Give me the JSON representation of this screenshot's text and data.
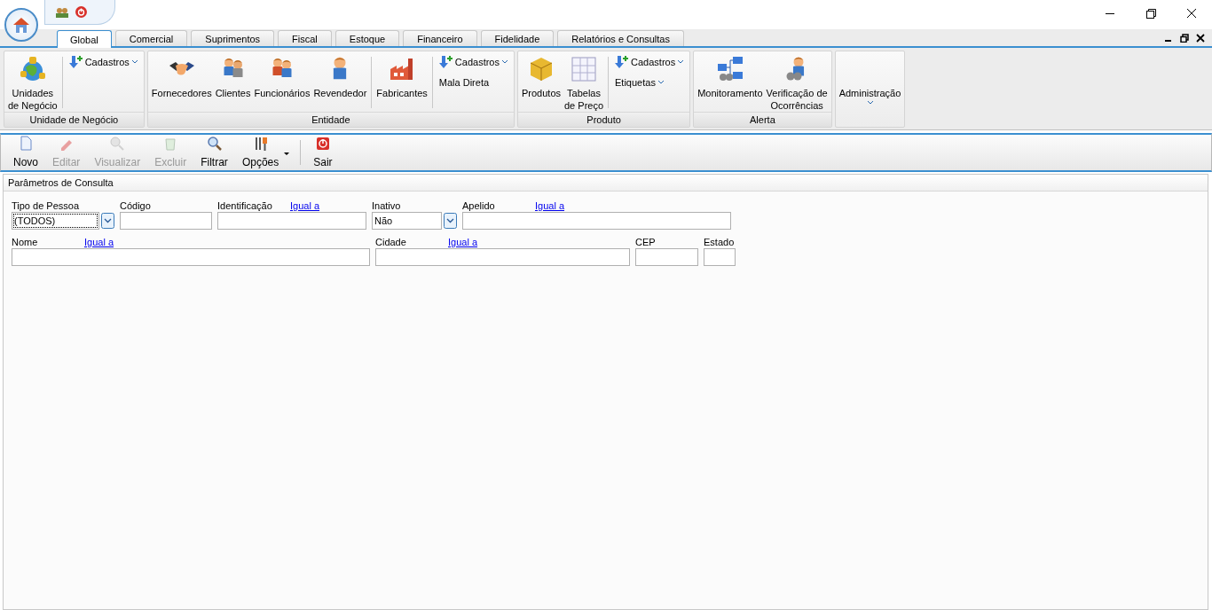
{
  "tabs": [
    {
      "label": "Global",
      "selected": true
    },
    {
      "label": "Comercial",
      "selected": false
    },
    {
      "label": "Suprimentos",
      "selected": false
    },
    {
      "label": "Fiscal",
      "selected": false
    },
    {
      "label": "Estoque",
      "selected": false
    },
    {
      "label": "Financeiro",
      "selected": false
    },
    {
      "label": "Fidelidade",
      "selected": false
    },
    {
      "label": "Relatórios e Consultas",
      "selected": false
    }
  ],
  "ribbon_groups": [
    {
      "title": "Unidade de Negócio",
      "items": [
        {
          "kind": "large",
          "lines": [
            "Unidades",
            "de Negócio"
          ]
        },
        {
          "kind": "separator"
        },
        {
          "kind": "stack",
          "items": [
            {
              "label": "Cadastros",
              "icon": true,
              "dropdown": true
            }
          ]
        }
      ]
    },
    {
      "title": "Entidade",
      "items": [
        {
          "kind": "large",
          "lines": [
            "Fornecedores"
          ]
        },
        {
          "kind": "large",
          "lines": [
            "Clientes"
          ]
        },
        {
          "kind": "large",
          "lines": [
            "Funcionários"
          ]
        },
        {
          "kind": "large",
          "lines": [
            "Revendedor"
          ]
        },
        {
          "kind": "separator"
        },
        {
          "kind": "large",
          "lines": [
            "Fabricantes"
          ]
        },
        {
          "kind": "separator"
        },
        {
          "kind": "stack",
          "items": [
            {
              "label": "Cadastros",
              "icon": true,
              "dropdown": true
            },
            {
              "label": "Mala Direta",
              "icon": false,
              "dropdown": false
            }
          ]
        }
      ]
    },
    {
      "title": "Produto",
      "items": [
        {
          "kind": "large",
          "lines": [
            "Produtos"
          ]
        },
        {
          "kind": "large",
          "lines": [
            "Tabelas",
            "de Preço"
          ]
        },
        {
          "kind": "separator"
        },
        {
          "kind": "stack",
          "items": [
            {
              "label": "Cadastros",
              "icon": true,
              "dropdown": true
            },
            {
              "label": "Etiquetas",
              "icon": false,
              "dropdown": true
            }
          ]
        }
      ]
    },
    {
      "title": "Alerta",
      "items": [
        {
          "kind": "large",
          "lines": [
            "Monitoramento"
          ]
        },
        {
          "kind": "large",
          "lines": [
            "Verificação de",
            "Ocorrências"
          ]
        }
      ]
    },
    {
      "items": [
        {
          "kind": "menu",
          "lines": [
            "Administração"
          ]
        }
      ]
    }
  ],
  "toolbar": [
    {
      "label": "Novo",
      "disabled": false
    },
    {
      "label": "Editar",
      "disabled": true
    },
    {
      "label": "Visualizar",
      "disabled": true
    },
    {
      "label": "Excluir",
      "disabled": true
    },
    {
      "label": "Filtrar",
      "disabled": false
    },
    {
      "label": "Opções",
      "disabled": false,
      "dropdown": true
    },
    {
      "label": "Sair",
      "disabled": false,
      "separator_before": true
    }
  ],
  "panel": {
    "title": "Parâmetros de Consulta",
    "fields": [
      {
        "label": "Tipo de Pessoa",
        "kind": "combo",
        "value": "(TODOS)",
        "focused": true
      },
      {
        "label": "Código",
        "kind": "text"
      },
      {
        "label": "Identificação",
        "link": "Igual a",
        "kind": "text"
      },
      {
        "label": "Inativo",
        "kind": "combo",
        "value": "Não",
        "focused": false
      },
      {
        "label": "Apelido",
        "link": "Igual a",
        "kind": "text"
      },
      {
        "label": "Nome",
        "link": "Igual a",
        "kind": "text"
      },
      {
        "label": "Cidade",
        "link": "Igual a",
        "kind": "text"
      },
      {
        "label": "CEP",
        "kind": "text"
      },
      {
        "label": "Estado",
        "kind": "text"
      }
    ]
  }
}
